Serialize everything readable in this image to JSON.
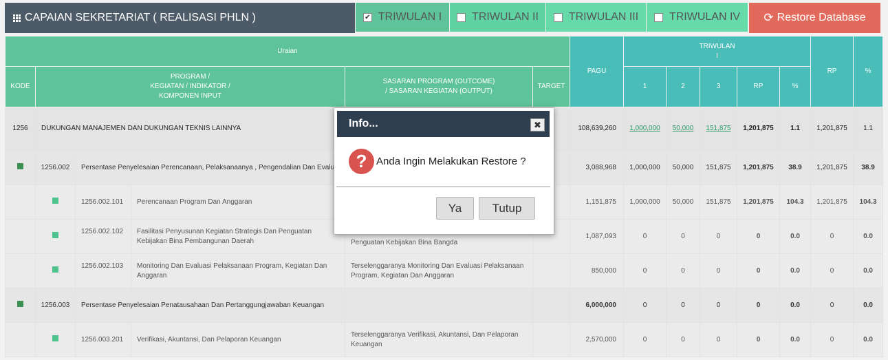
{
  "header": {
    "title": "CAPAIAN SEKRETARIAT ( REALISASI PHLN )",
    "tabs": [
      {
        "label": "TRIWULAN I",
        "checked": true,
        "color": "#5fc39a"
      },
      {
        "label": "TRIWULAN II",
        "checked": false,
        "color": "#60d3a3"
      },
      {
        "label": "TRIWULAN III",
        "checked": false,
        "color": "#66dba9"
      },
      {
        "label": "TRIWULAN IV",
        "checked": false,
        "color": "#66dba9"
      }
    ],
    "restore_label": "Restore Database",
    "restore_icon": "refresh-icon"
  },
  "table": {
    "uraian": "Uraian",
    "kode": "KODE",
    "program": "PROGRAM / KEGIATAN / INDIKATOR / KOMPONEN INPUT",
    "program_lines": [
      "PROGRAM /",
      "KEGIATAN / INDIKATOR /",
      "KOMPONEN INPUT"
    ],
    "sasaran_lines": [
      "SASARAN PROGRAM (OUTCOME)",
      "/ SASARAN KEGIATAN (OUTPUT)"
    ],
    "target": "TARGET",
    "pagu": "PAGU",
    "triwulan_lines": [
      "TRIWULAN",
      "I"
    ],
    "sub_cols": [
      "1",
      "2",
      "3",
      "RP",
      "%"
    ],
    "rp": "RP",
    "pct": "%",
    "rows": [
      {
        "level": 1,
        "code": "1256",
        "name": "DUKUNGAN MANAJEMEN DAN DUKUNGAN TEKNIS LAINNYA",
        "sasaran": "",
        "target": "",
        "pagu": "108,639,260",
        "m1": "1,000,000",
        "m2": "50,000",
        "m3": "151,875",
        "rp": "1,201,875",
        "pct": "1.1",
        "rp_total": "1,201,875",
        "pct_total": "1.1"
      },
      {
        "level": 2,
        "code": "1256.002",
        "name": "Persentase Penyelesaian Perencanaan, Pelaksanaanya , Pengendalian Dan Evaluasi Program Dan Kegiatan Ditjen Bina Bangda",
        "sasaran": "",
        "target": "",
        "pagu": "3,088,968",
        "m1": "1,000,000",
        "m2": "50,000",
        "m3": "151,875",
        "rp": "1,201,875",
        "pct": "38.9",
        "rp_total": "1,201,875",
        "pct_total": "38.9"
      },
      {
        "level": 3,
        "code": "1256.002.101",
        "name": "Perencanaan Program Dan Anggaran",
        "sasaran": "",
        "target": "",
        "pagu": "1,151,875",
        "m1": "1,000,000",
        "m2": "50,000",
        "m3": "151,875",
        "rp": "1,201,875",
        "pct": "104.3",
        "rp_total": "1,201,875",
        "pct_total": "104.3"
      },
      {
        "level": 3,
        "code": "1256.002.102",
        "name": "Fasilitasi Penyusunan Kegiatan Strategis Dan Penguatan Kebijakan Bina Pembangunan Daerah",
        "sasaran": "Penguatan Kebijakan Bina Bangda",
        "target": "",
        "pagu": "1,087,093",
        "m1": "0",
        "m2": "0",
        "m3": "0",
        "rp": "0",
        "pct": "0.0",
        "rp_total": "0",
        "pct_total": "0.0"
      },
      {
        "level": 3,
        "code": "1256.002.103",
        "name": "Monitoring Dan Evaluasi Pelaksanaan Program, Kegiatan Dan Anggaran",
        "sasaran": "Terselenggaranya Monitoring Dan Evaluasi Pelaksanaan Program, Kegiatan Dan Anggaran",
        "target": "",
        "pagu": "850,000",
        "m1": "0",
        "m2": "0",
        "m3": "0",
        "rp": "0",
        "pct": "0.0",
        "rp_total": "0",
        "pct_total": "0.0"
      },
      {
        "level": 2,
        "code": "1256.003",
        "name": "Persentase Penyelesaian Penatausahaan Dan Pertanggungjawaban Keuangan",
        "sasaran": "",
        "target": "",
        "pagu": "6,000,000",
        "m1": "0",
        "m2": "0",
        "m3": "0",
        "rp": "0",
        "pct": "0.0",
        "rp_total": "0",
        "pct_total": "0.0"
      },
      {
        "level": 3,
        "code": "1256.003.201",
        "name": "Verifikasi, Akuntansi, Dan Pelaporan Keuangan",
        "sasaran": "Terselenggaranya Verifikasi, Akuntansi, Dan Pelaporan Keuangan",
        "target": "",
        "pagu": "2,570,000",
        "m1": "0",
        "m2": "0",
        "m3": "0",
        "rp": "0",
        "pct": "0.0",
        "rp_total": "0",
        "pct_total": "0.0"
      }
    ]
  },
  "modal": {
    "title": "Info...",
    "close_glyph": "✖",
    "icon_glyph": "?",
    "message": "Anda Ingin Melakukan Restore ?",
    "ok_label": "Ya",
    "cancel_label": "Tutup"
  }
}
